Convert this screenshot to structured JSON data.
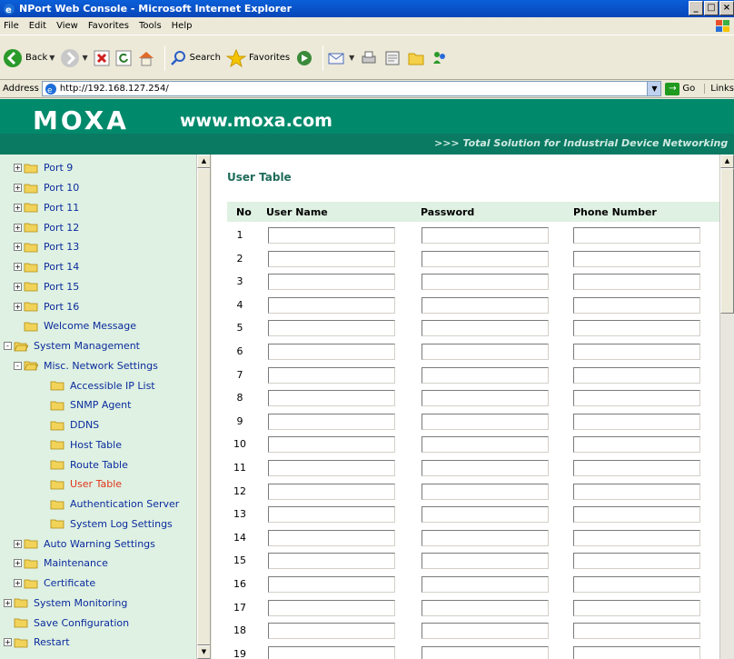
{
  "window": {
    "title": "NPort Web Console - Microsoft Internet Explorer",
    "buttons": [
      "_",
      "□",
      "×"
    ]
  },
  "menu": [
    "File",
    "Edit",
    "View",
    "Favorites",
    "Tools",
    "Help"
  ],
  "toolbar": {
    "back_label": "Back",
    "search_label": "Search",
    "favorites_label": "Favorites"
  },
  "address": {
    "label": "Address",
    "url": "http://192.168.127.254/",
    "go_label": "Go",
    "links_label": "Links"
  },
  "header": {
    "logo": "MOXA",
    "site": "www.moxa.com",
    "tagline": "Total Solution for Industrial Device Networking"
  },
  "tree": [
    {
      "label": "Port 9",
      "level": 1,
      "expander": "+"
    },
    {
      "label": "Port 10",
      "level": 1,
      "expander": "+"
    },
    {
      "label": "Port 11",
      "level": 1,
      "expander": "+"
    },
    {
      "label": "Port 12",
      "level": 1,
      "expander": "+"
    },
    {
      "label": "Port 13",
      "level": 1,
      "expander": "+"
    },
    {
      "label": "Port 14",
      "level": 1,
      "expander": "+"
    },
    {
      "label": "Port 15",
      "level": 1,
      "expander": "+"
    },
    {
      "label": "Port 16",
      "level": 1,
      "expander": "+"
    },
    {
      "label": "Welcome Message",
      "level": 1,
      "expander": ""
    },
    {
      "label": "System Management",
      "level": 0,
      "expander": "-",
      "open": true
    },
    {
      "label": "Misc. Network Settings",
      "level": 1,
      "expander": "-",
      "open": true
    },
    {
      "label": "Accessible IP List",
      "level": 2,
      "expander": ""
    },
    {
      "label": "SNMP Agent",
      "level": 2,
      "expander": ""
    },
    {
      "label": "DDNS",
      "level": 2,
      "expander": ""
    },
    {
      "label": "Host Table",
      "level": 2,
      "expander": ""
    },
    {
      "label": "Route Table",
      "level": 2,
      "expander": ""
    },
    {
      "label": "User Table",
      "level": 2,
      "expander": "",
      "active": true
    },
    {
      "label": "Authentication Server",
      "level": 2,
      "expander": ""
    },
    {
      "label": "System Log Settings",
      "level": 2,
      "expander": ""
    },
    {
      "label": "Auto Warning Settings",
      "level": 1,
      "expander": "+"
    },
    {
      "label": "Maintenance",
      "level": 1,
      "expander": "+"
    },
    {
      "label": "Certificate",
      "level": 1,
      "expander": "+"
    },
    {
      "label": "System Monitoring",
      "level": 0,
      "expander": "+"
    },
    {
      "label": "Save Configuration",
      "level": 0,
      "expander": ""
    },
    {
      "label": "Restart",
      "level": 0,
      "expander": "+"
    }
  ],
  "page": {
    "title": "User Table",
    "columns": [
      "No",
      "User Name",
      "Password",
      "Phone Number"
    ],
    "rows": [
      "1",
      "2",
      "3",
      "4",
      "5",
      "6",
      "7",
      "8",
      "9",
      "10",
      "11",
      "12",
      "13",
      "14",
      "15",
      "16",
      "17",
      "18",
      "19"
    ]
  },
  "colors": {
    "brand": "#00896b",
    "tree_bg": "#dff1e2",
    "active_item": "#e0341a",
    "link": "#0a2b9e"
  }
}
